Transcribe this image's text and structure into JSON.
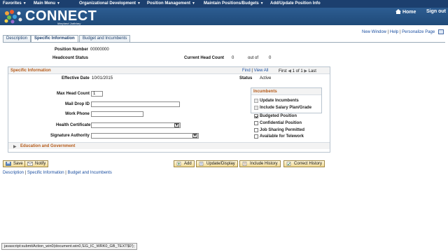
{
  "topnav": {
    "items": [
      {
        "label": "Favorites"
      },
      {
        "label": "Main Menu"
      },
      {
        "label": "Organizational Development"
      },
      {
        "label": "Position Management"
      },
      {
        "label": "Maintain Positions/Budgets"
      },
      {
        "label": "Add/Update Position Info"
      }
    ],
    "home": "Home",
    "signout": "Sign out"
  },
  "banner": {
    "logo_text": "CONNECT",
    "logo_sub": "Maryland Judiciary"
  },
  "pagelinks": {
    "new_window": "New Window",
    "help": "Help",
    "personalize": "Personalize Page"
  },
  "tabs": [
    {
      "label": "Description"
    },
    {
      "label": "Specific Information"
    },
    {
      "label": "Budget and Incumbents"
    }
  ],
  "header": {
    "position_number_label": "Position Number",
    "position_number_value": "00000000",
    "headcount_status_label": "Headcount Status",
    "current_head_count_label": "Current Head Count",
    "current_head_count_value": "0",
    "out_of_label": "out of",
    "out_of_value": "0"
  },
  "group": {
    "title": "Specific Information",
    "find": "Find",
    "view_all": "View All",
    "first": "First",
    "pager": "1 of 1",
    "last": "Last",
    "effective_date_label": "Effective Date",
    "effective_date_value": "10/01/2015",
    "status_label": "Status",
    "status_value": "Active"
  },
  "form": {
    "max_head_count_label": "Max Head Count",
    "max_head_count_value": "1",
    "mail_drop_label": "Mail Drop ID",
    "mail_drop_value": "",
    "work_phone_label": "Work Phone",
    "work_phone_value": "",
    "health_cert_label": "Health Certificate",
    "health_cert_value": "",
    "sig_auth_label": "Signature Authority",
    "sig_auth_value": ""
  },
  "incumbents": {
    "title": "Incumbents",
    "update_incumbents": "Update Incumbents",
    "include_salary": "Include Salary Plan/Grade"
  },
  "checkboxes": {
    "budgeted": "Budgeted Position",
    "confidential": "Confidential Position",
    "job_sharing": "Job Sharing Permitted",
    "telework": "Available for Telework",
    "budgeted_checked": true,
    "confidential_checked": false,
    "job_sharing_checked": false,
    "telework_checked": false
  },
  "section": {
    "education": "Education and Government"
  },
  "buttons": {
    "save": "Save",
    "notify": "Notify",
    "add": "Add",
    "update_display": "Update/Display",
    "include_history": "Include History",
    "correct_history": "Correct History"
  },
  "bottomlinks": [
    {
      "label": "Description"
    },
    {
      "label": "Specific Information"
    },
    {
      "label": "Budget and Incumbents"
    }
  ],
  "statusbar": "javascript:submitAction_win0(document.win0,'EG_IC_WRK0_GB_TEXT$0');"
}
